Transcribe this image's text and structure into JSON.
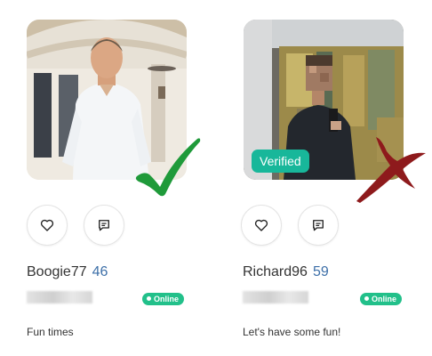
{
  "colors": {
    "accent_green": "#18b79a",
    "online_green": "#22c08a",
    "age_blue": "#3d6fa8",
    "check_green": "#1f9a3a",
    "cross_red": "#8e1a1c"
  },
  "profiles": [
    {
      "username": "Boogie77",
      "age": "46",
      "status": "Online",
      "bio": "Fun times",
      "verified_label": "",
      "like_icon": "heart-icon",
      "message_icon": "message-icon",
      "mark": "checkmark-icon"
    },
    {
      "username": "Richard96",
      "age": "59",
      "status": "Online",
      "bio": "Let's have some fun!",
      "verified_label": "Verified",
      "like_icon": "heart-icon",
      "message_icon": "message-icon",
      "mark": "cross-icon"
    }
  ]
}
